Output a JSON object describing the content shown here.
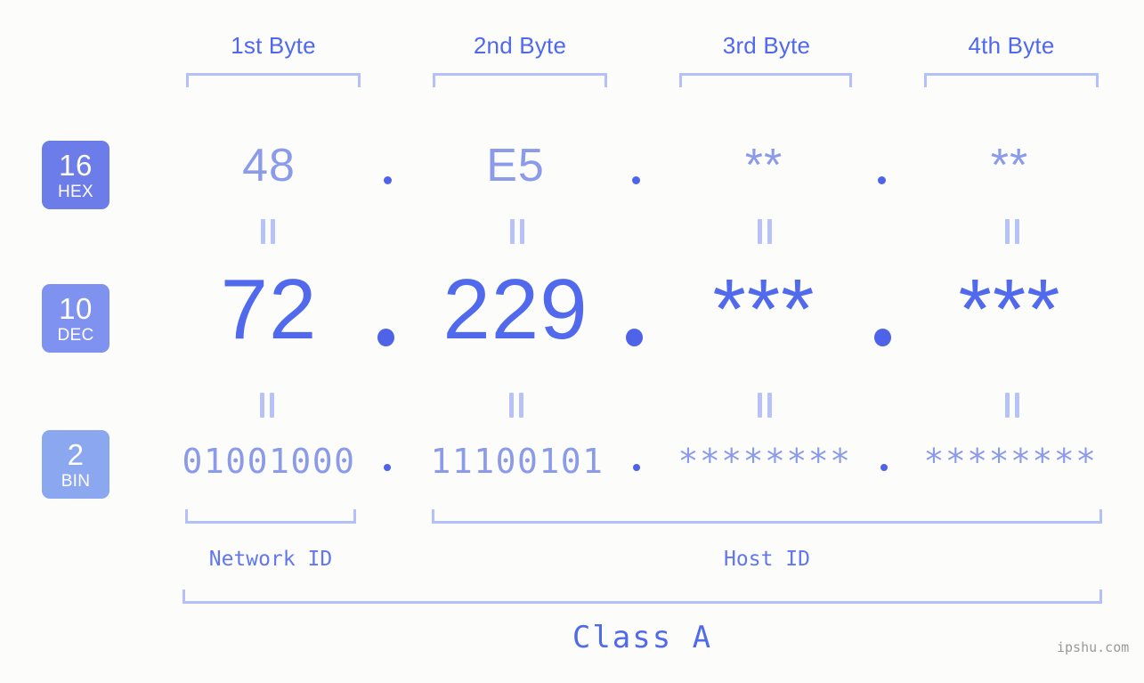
{
  "background_color": "#fcfdfa",
  "accent_colors": {
    "strong_blue": "#5069ed",
    "light_blue": "#8b9bea",
    "bracket_blue": "#b4c0f9",
    "badge_hex": "#6c7ce8",
    "badge_dec": "#7f92ef",
    "badge_bin": "#8ba7f0",
    "watermark_gray": "#9a9a9a"
  },
  "byte_headers": [
    {
      "label": "1st Byte"
    },
    {
      "label": "2nd Byte"
    },
    {
      "label": "3rd Byte"
    },
    {
      "label": "4th Byte"
    }
  ],
  "radix_badges": [
    {
      "number": "16",
      "system": "HEX"
    },
    {
      "number": "10",
      "system": "DEC"
    },
    {
      "number": "2",
      "system": "BIN"
    }
  ],
  "rows": {
    "hex": {
      "values": [
        "48",
        "E5",
        "**",
        "**"
      ],
      "separator": "."
    },
    "dec": {
      "values": [
        "72",
        "229",
        "***",
        "***"
      ],
      "separator": "."
    },
    "bin": {
      "values": [
        "01001000",
        "11100101",
        "********",
        "********"
      ],
      "separator": "."
    }
  },
  "equals_symbol": "=",
  "id_captions": [
    {
      "label": "Network ID"
    },
    {
      "label": "Host ID"
    }
  ],
  "class_caption": "Class A",
  "watermark": "ipshu.com"
}
